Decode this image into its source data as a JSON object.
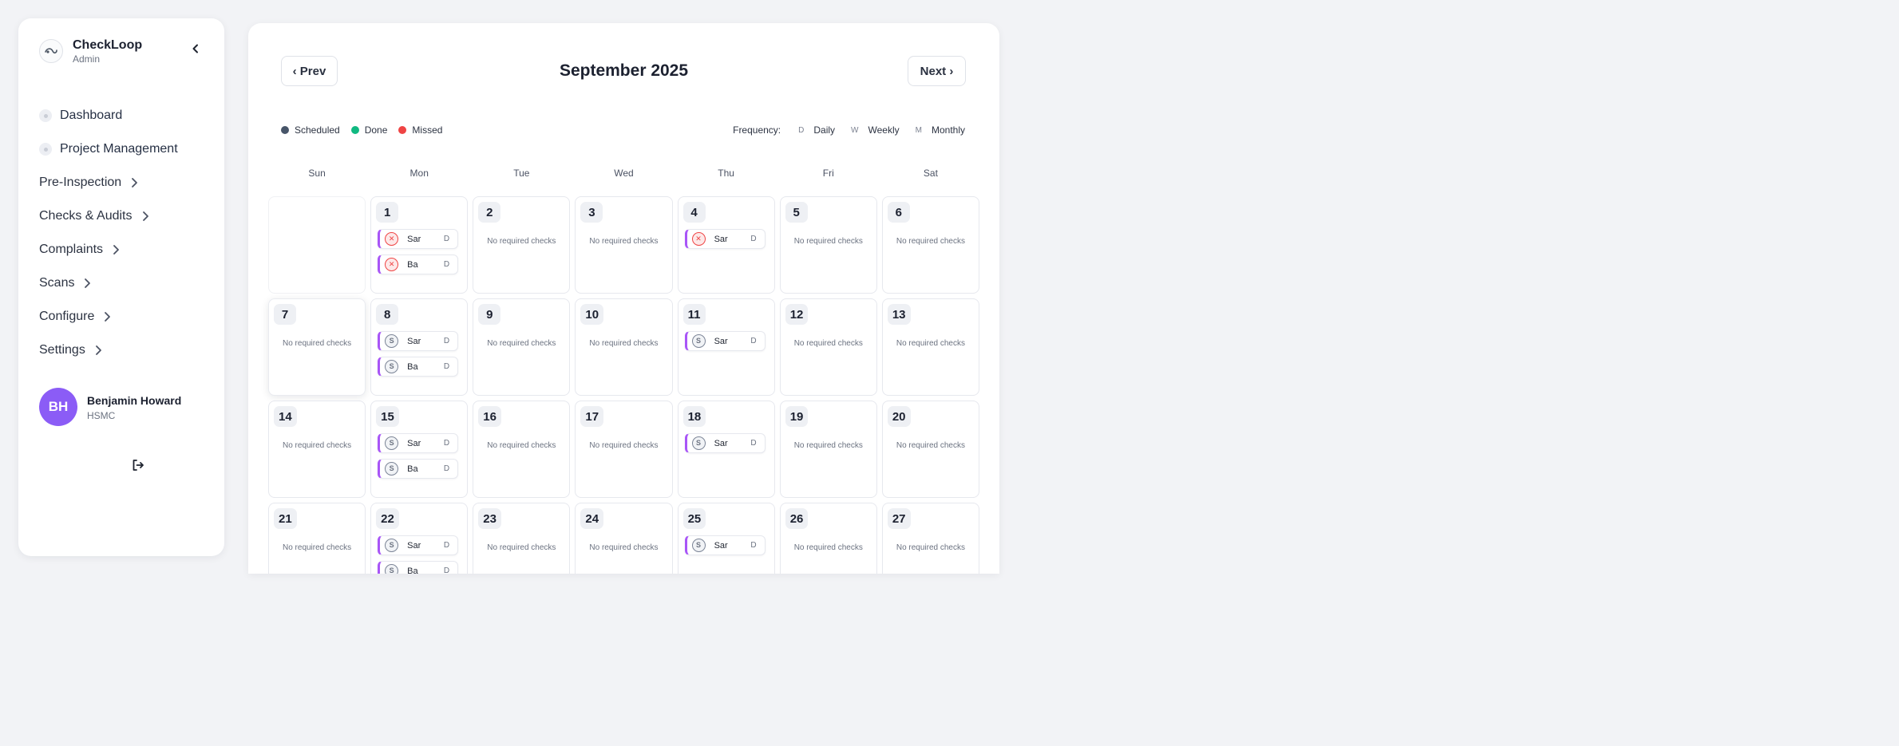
{
  "app": {
    "name": "CheckLoop",
    "role": "Admin"
  },
  "sidebar": {
    "items": [
      {
        "label": "Dashboard",
        "kind": "link",
        "name": "sidebar-item-dashboard"
      },
      {
        "label": "Project Management",
        "kind": "link",
        "name": "sidebar-item-project-management"
      },
      {
        "label": "Pre-Inspection",
        "kind": "group",
        "name": "sidebar-item-pre-inspection"
      },
      {
        "label": "Checks & Audits",
        "kind": "group",
        "name": "sidebar-item-checks-audits"
      },
      {
        "label": "Complaints",
        "kind": "group",
        "name": "sidebar-item-complaints"
      },
      {
        "label": "Scans",
        "kind": "group",
        "name": "sidebar-item-scans"
      },
      {
        "label": "Configure",
        "kind": "group",
        "name": "sidebar-item-configure"
      },
      {
        "label": "Settings",
        "kind": "group",
        "name": "sidebar-item-settings"
      }
    ]
  },
  "user": {
    "initials": "BH",
    "name": "Benjamin Howard",
    "org": "HSMC"
  },
  "calendar": {
    "prev_label": "‹ Prev",
    "next_label": "Next ›",
    "month_title": "September 2025",
    "legend": [
      {
        "label": "Scheduled",
        "color": "#475569"
      },
      {
        "label": "Done",
        "color": "#10b981"
      },
      {
        "label": "Missed",
        "color": "#ef4444"
      }
    ],
    "frequency_label": "Frequency:",
    "frequencies": [
      {
        "code": "D",
        "label": "Daily"
      },
      {
        "code": "W",
        "label": "Weekly"
      },
      {
        "code": "M",
        "label": "Monthly"
      }
    ],
    "weekdays": [
      "Sun",
      "Mon",
      "Tue",
      "Wed",
      "Thu",
      "Fri",
      "Sat"
    ],
    "no_checks_text": "No required checks",
    "check_accent_color": "#a855f7",
    "days": [
      {
        "day": null
      },
      {
        "day": "1",
        "checks": [
          {
            "name": "Sar",
            "status": "missed",
            "freq": "D"
          },
          {
            "name": "Ba",
            "status": "missed",
            "freq": "D"
          }
        ]
      },
      {
        "day": "2",
        "checks": []
      },
      {
        "day": "3",
        "checks": []
      },
      {
        "day": "4",
        "checks": [
          {
            "name": "Sar",
            "status": "missed",
            "freq": "D"
          }
        ]
      },
      {
        "day": "5",
        "checks": []
      },
      {
        "day": "6",
        "checks": []
      },
      {
        "day": "7",
        "checks": [],
        "today": true
      },
      {
        "day": "8",
        "checks": [
          {
            "name": "Sar",
            "status": "scheduled",
            "freq": "D"
          },
          {
            "name": "Ba",
            "status": "scheduled",
            "freq": "D"
          }
        ]
      },
      {
        "day": "9",
        "checks": []
      },
      {
        "day": "10",
        "checks": []
      },
      {
        "day": "11",
        "checks": [
          {
            "name": "Sar",
            "status": "scheduled",
            "freq": "D"
          }
        ]
      },
      {
        "day": "12",
        "checks": []
      },
      {
        "day": "13",
        "checks": []
      },
      {
        "day": "14",
        "checks": []
      },
      {
        "day": "15",
        "checks": [
          {
            "name": "Sar",
            "status": "scheduled",
            "freq": "D"
          },
          {
            "name": "Ba",
            "status": "scheduled",
            "freq": "D"
          }
        ]
      },
      {
        "day": "16",
        "checks": []
      },
      {
        "day": "17",
        "checks": []
      },
      {
        "day": "18",
        "checks": [
          {
            "name": "Sar",
            "status": "scheduled",
            "freq": "D"
          }
        ]
      },
      {
        "day": "19",
        "checks": []
      },
      {
        "day": "20",
        "checks": []
      },
      {
        "day": "21",
        "checks": []
      },
      {
        "day": "22",
        "checks": [
          {
            "name": "Sar",
            "status": "scheduled",
            "freq": "D"
          },
          {
            "name": "Ba",
            "status": "scheduled",
            "freq": "D"
          }
        ]
      },
      {
        "day": "23",
        "checks": []
      },
      {
        "day": "24",
        "checks": []
      },
      {
        "day": "25",
        "checks": [
          {
            "name": "Sar",
            "status": "scheduled",
            "freq": "D"
          }
        ]
      },
      {
        "day": "26",
        "checks": []
      },
      {
        "day": "27",
        "checks": []
      }
    ],
    "status_icons": {
      "missed": "✕",
      "scheduled": "S"
    }
  }
}
